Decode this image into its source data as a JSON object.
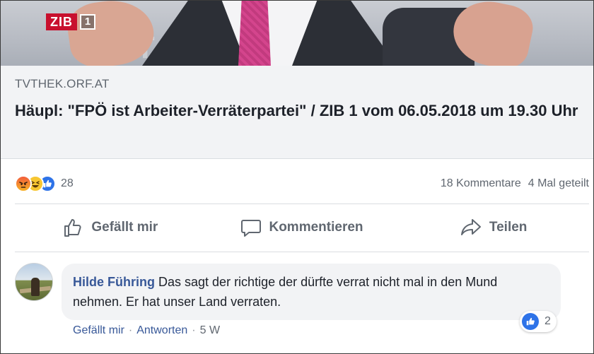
{
  "video": {
    "logo_text": "ZIB",
    "logo_num": "1"
  },
  "link": {
    "domain": "TVTHEK.ORF.AT",
    "title": "Häupl: \"FPÖ ist Arbeiter-Verräterpartei\" / ZIB 1 vom 06.05.2018 um 19.30 Uhr"
  },
  "reactions": {
    "types": [
      "angry",
      "haha",
      "like"
    ],
    "count": "28",
    "comments": "18 Kommentare",
    "shares": "4 Mal geteilt"
  },
  "actions": {
    "like": "Gefällt mir",
    "comment": "Kommentieren",
    "share": "Teilen"
  },
  "comment": {
    "author": "Hilde Führing",
    "text": "Das sagt der richtige der dürfte verrat nicht mal in den Mund nehmen. Er hat unser Land verraten.",
    "reaction_count": "2",
    "like_link": "Gefällt mir",
    "reply_link": "Antworten",
    "time": "5 W",
    "separator": "·"
  },
  "colors": {
    "link_blue": "#385898",
    "like_blue": "#2e73e8",
    "muted": "#606770",
    "zib_red": "#c8102e"
  }
}
